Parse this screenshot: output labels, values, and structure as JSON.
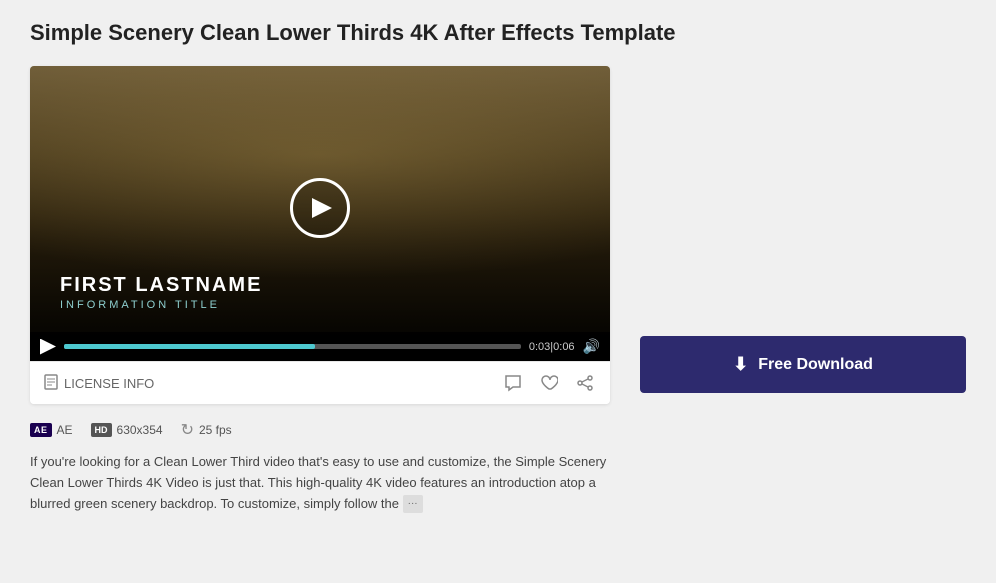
{
  "page": {
    "title": "Simple Scenery Clean Lower Thirds 4K After Effects Template"
  },
  "video": {
    "lower_third": {
      "name": "FIRST LASTNAME",
      "title": "INFORMATION TITLE"
    },
    "controls": {
      "time_current": "0:03",
      "time_total": "0:06",
      "progress_percent": 55
    }
  },
  "footer": {
    "license_label": "LICENSE INFO",
    "actions": {
      "comment_label": "comment",
      "like_label": "like",
      "share_label": "share"
    }
  },
  "meta": {
    "software": "AE",
    "resolution": "630x354",
    "fps": "25 fps"
  },
  "description": "If you're looking for a Clean Lower Third video that's easy to use and customize, the Simple Scenery Clean Lower Thirds 4K Video is just that. This high-quality 4K video features an introduction atop a blurred green scenery backdrop. To customize, simply follow the",
  "download": {
    "button_label": "Free Download"
  }
}
